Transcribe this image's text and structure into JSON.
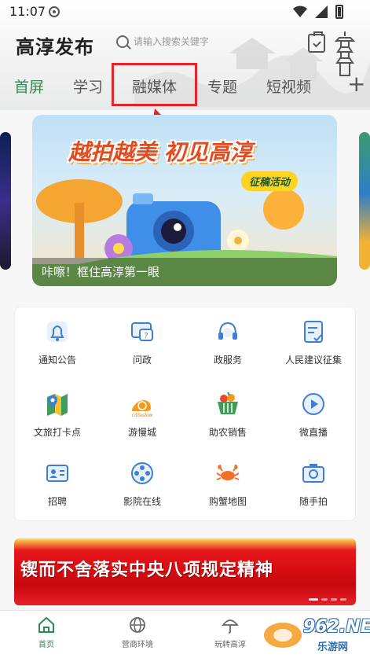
{
  "status_bar": {
    "time": "11:07"
  },
  "header": {
    "brand": "高淳发布",
    "search_placeholder": "请输入搜索关键字"
  },
  "tabs": [
    {
      "label": "首屏",
      "active": true
    },
    {
      "label": "学习",
      "active": false
    },
    {
      "label": "融媒体",
      "active": false
    },
    {
      "label": "专题",
      "active": false
    },
    {
      "label": "短视频",
      "active": false
    }
  ],
  "tab_add_label": "+",
  "banner": {
    "title": "越拍越美 初见高淳",
    "badge": "征稿活动",
    "caption": "咔嚓！框住高淳第一眼"
  },
  "services": [
    {
      "label": "通知公告",
      "icon": "bell-icon"
    },
    {
      "label": "问政",
      "icon": "question-chat-icon"
    },
    {
      "label": "政服务",
      "icon": "headset-icon"
    },
    {
      "label": "人民建议征集",
      "icon": "suggestion-form-icon"
    },
    {
      "label": "文旅打卡点",
      "icon": "map-pin-icon"
    },
    {
      "label": "游慢城",
      "icon": "cittaslow-snail-icon"
    },
    {
      "label": "助农销售",
      "icon": "produce-basket-icon"
    },
    {
      "label": "微直播",
      "icon": "live-play-icon"
    },
    {
      "label": "招聘",
      "icon": "id-card-icon"
    },
    {
      "label": "影院在线",
      "icon": "film-reel-icon"
    },
    {
      "label": "购蟹地图",
      "icon": "crab-icon"
    },
    {
      "label": "随手拍",
      "icon": "camera-icon"
    }
  ],
  "promo": {
    "text": "锲而不舍落实中央八项规定精神"
  },
  "bottom_nav": [
    {
      "label": "首页",
      "icon": "home-icon",
      "active": true
    },
    {
      "label": "营商环境",
      "icon": "globe-icon",
      "active": false
    },
    {
      "label": "玩转高淳",
      "icon": "umbrella-icon",
      "active": false
    },
    {
      "label": "",
      "icon": "user-icon",
      "active": false
    }
  ],
  "watermark": {
    "text": "962.NET",
    "sub": "乐游网"
  },
  "colors": {
    "accent_green": "#2f8a54",
    "highlight_red": "#e5242b",
    "icon_blue": "#3d7fd6"
  }
}
